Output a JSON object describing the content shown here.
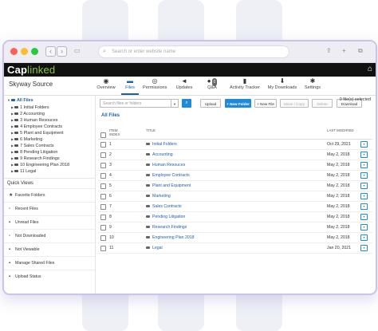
{
  "browser": {
    "url_placeholder": "Search or enter website name"
  },
  "brand": {
    "logo_cap": "Cap",
    "logo_linked": "linked"
  },
  "project": {
    "title": "Skyway Source"
  },
  "tabs": [
    {
      "label": "Overview",
      "icon": "globe-icon"
    },
    {
      "label": "Files",
      "icon": "files-icon"
    },
    {
      "label": "Permissions",
      "icon": "eye-icon"
    },
    {
      "label": "Updates",
      "icon": "megaphone-icon"
    },
    {
      "label": "Q&A",
      "icon": "chat-icon",
      "badge": "0"
    },
    {
      "label": "Activity Tracker",
      "icon": "bar-chart-icon"
    },
    {
      "label": "My Downloads",
      "icon": "download-icon"
    },
    {
      "label": "Settings",
      "icon": "gear-icon"
    }
  ],
  "tree": {
    "root": "All Files",
    "items": [
      "1 Initial Folders",
      "2 Accounting",
      "3 Human Resouces",
      "4 Employee Contracts",
      "5 Plant and Equipment",
      "6 Marketing",
      "7 Sales Contracts",
      "8 Pending Litigation",
      "9 Research Findings",
      "10 Engineering Plan 2018",
      "11 Legal"
    ]
  },
  "quick_views": {
    "title": "Quick Views",
    "items": [
      {
        "label": "Favorite Folders",
        "icon": "star-icon"
      },
      {
        "label": "Recent Files",
        "icon": "recent-icon"
      },
      {
        "label": "Unread Files",
        "icon": "unread-icon"
      },
      {
        "label": "Not Downloaded",
        "icon": "not-downloaded-icon"
      },
      {
        "label": "Not Viewable",
        "icon": "not-viewable-icon"
      },
      {
        "label": "Manage Shared Files",
        "icon": "shared-icon"
      },
      {
        "label": "Upload Status",
        "icon": "upload-status-icon"
      }
    ]
  },
  "toolbar": {
    "search_placeholder": "Search files or folders",
    "upload": "Upload",
    "new_folder": "+ New Folder",
    "new_file": "+ New File",
    "move_copy": "Move / Copy",
    "delete": "Delete",
    "download": "Download",
    "selection_info": "0 file(s) selected"
  },
  "breadcrumb": "All Files",
  "table": {
    "headers": {
      "index": "ITEM\nINDEX",
      "title": "TITLE",
      "date": "LAST MODIFIED"
    },
    "rows": [
      {
        "index": "1",
        "title": "Initial Folders",
        "date": "Oct 29, 2021"
      },
      {
        "index": "2",
        "title": "Accounting",
        "date": "May 2, 2018"
      },
      {
        "index": "3",
        "title": "Human Resouces",
        "date": "May 2, 2018"
      },
      {
        "index": "4",
        "title": "Employee Contracts",
        "date": "May 2, 2018"
      },
      {
        "index": "5",
        "title": "Plant and Equipment",
        "date": "May 2, 2018"
      },
      {
        "index": "6",
        "title": "Marketing",
        "date": "May 2, 2018"
      },
      {
        "index": "7",
        "title": "Sales Contracts",
        "date": "May 2, 2018"
      },
      {
        "index": "8",
        "title": "Pending Litigation",
        "date": "May 2, 2018"
      },
      {
        "index": "9",
        "title": "Research Findings",
        "date": "May 2, 2018"
      },
      {
        "index": "10",
        "title": "Engineering Plan 2018",
        "date": "May 2, 2018"
      },
      {
        "index": "11",
        "title": "Legal",
        "date": "Jan 20, 2021"
      }
    ]
  },
  "colors": {
    "accent": "#1f5fa8",
    "button": "#1f8ad8",
    "brand_green": "#8cc63f",
    "frame": "#c9c4e8"
  }
}
